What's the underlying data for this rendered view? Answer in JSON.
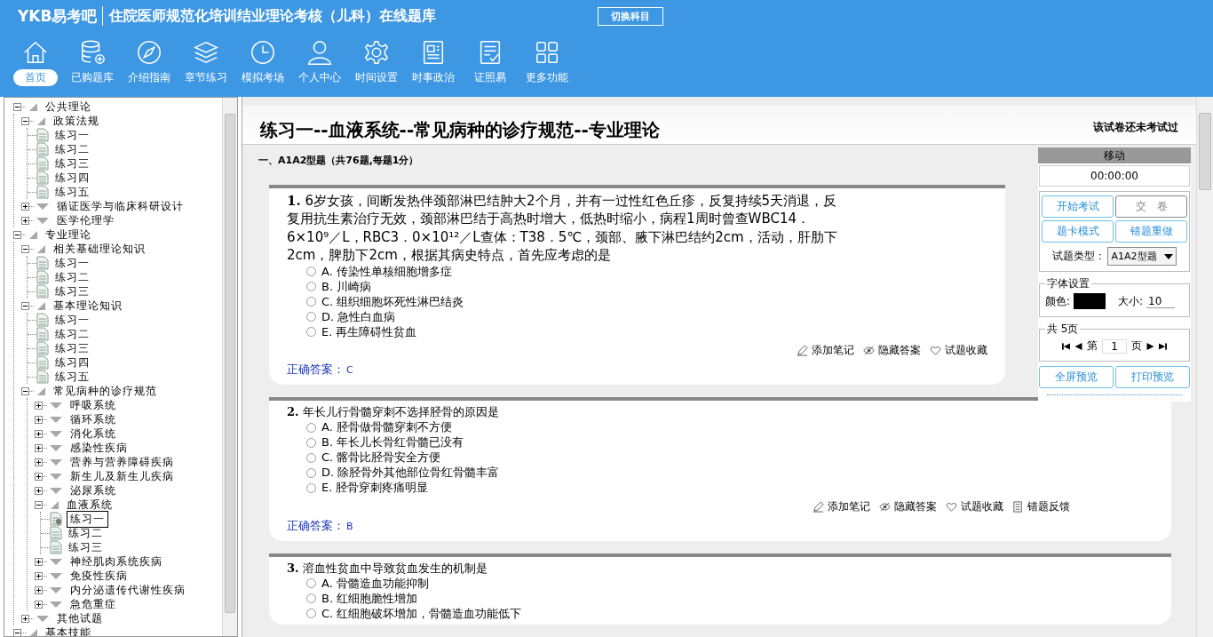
{
  "app": {
    "logo": "YKB易考吧",
    "title": "住院医师规范化培训结业理论考核（儿科）在线题库",
    "switch_button": "切换科目"
  },
  "nav": [
    {
      "label": "首页",
      "selected": true
    },
    {
      "label": "已购题库",
      "selected": false
    },
    {
      "label": "介绍指南",
      "selected": false
    },
    {
      "label": "章节练习",
      "selected": false
    },
    {
      "label": "模拟考场",
      "selected": false
    },
    {
      "label": "个人中心",
      "selected": false
    },
    {
      "label": "时间设置",
      "selected": false
    },
    {
      "label": "时事政治",
      "selected": false
    },
    {
      "label": "证照易",
      "selected": false
    },
    {
      "label": "更多功能",
      "selected": false
    }
  ],
  "tree": [
    {
      "label": "公共理论",
      "kind": "folder",
      "expanded": true,
      "children": [
        {
          "label": "政策法规",
          "kind": "folder",
          "expanded": true,
          "children": [
            {
              "label": "练习一",
              "kind": "doc",
              "selected": false
            },
            {
              "label": "练习二",
              "kind": "doc",
              "selected": false
            },
            {
              "label": "练习三",
              "kind": "doc",
              "selected": false
            },
            {
              "label": "练习四",
              "kind": "doc",
              "selected": false
            },
            {
              "label": "练习五",
              "kind": "doc",
              "selected": false
            }
          ]
        },
        {
          "label": "循证医学与临床科研设计",
          "kind": "folder",
          "expanded": false
        },
        {
          "label": "医学伦理学",
          "kind": "folder",
          "expanded": false
        }
      ]
    },
    {
      "label": "专业理论",
      "kind": "folder",
      "expanded": true,
      "children": [
        {
          "label": "相关基础理论知识",
          "kind": "folder",
          "expanded": true,
          "children": [
            {
              "label": "练习一",
              "kind": "doc",
              "selected": false
            },
            {
              "label": "练习二",
              "kind": "doc",
              "selected": false
            },
            {
              "label": "练习三",
              "kind": "doc",
              "selected": false
            }
          ]
        },
        {
          "label": "基本理论知识",
          "kind": "folder",
          "expanded": true,
          "children": [
            {
              "label": "练习一",
              "kind": "doc",
              "selected": false
            },
            {
              "label": "练习二",
              "kind": "doc",
              "selected": false
            },
            {
              "label": "练习三",
              "kind": "doc",
              "selected": false
            },
            {
              "label": "练习四",
              "kind": "doc",
              "selected": false
            },
            {
              "label": "练习五",
              "kind": "doc",
              "selected": false
            }
          ]
        },
        {
          "label": "常见病种的诊疗规范",
          "kind": "folder",
          "expanded": true,
          "children": [
            {
              "label": "呼吸系统",
              "kind": "folder",
              "expanded": false
            },
            {
              "label": "循环系统",
              "kind": "folder",
              "expanded": false
            },
            {
              "label": "消化系统",
              "kind": "folder",
              "expanded": false
            },
            {
              "label": "感染性疾病",
              "kind": "folder",
              "expanded": false
            },
            {
              "label": "营养与营养障碍疾病",
              "kind": "folder",
              "expanded": false
            },
            {
              "label": "新生儿及新生儿疾病",
              "kind": "folder",
              "expanded": false
            },
            {
              "label": "泌尿系统",
              "kind": "folder",
              "expanded": false
            },
            {
              "label": "血液系统",
              "kind": "folder",
              "expanded": true,
              "children": [
                {
                  "label": "练习一",
                  "kind": "doc",
                  "selected": true
                },
                {
                  "label": "练习二",
                  "kind": "doc",
                  "selected": false
                },
                {
                  "label": "练习三",
                  "kind": "doc",
                  "selected": false
                }
              ]
            },
            {
              "label": "神经肌肉系统疾病",
              "kind": "folder",
              "expanded": false
            },
            {
              "label": "免疫性疾病",
              "kind": "folder",
              "expanded": false
            },
            {
              "label": "内分泌遗传代谢性疾病",
              "kind": "folder",
              "expanded": false
            },
            {
              "label": "急危重症",
              "kind": "folder",
              "expanded": false
            }
          ]
        },
        {
          "label": "其他试题",
          "kind": "folder",
          "expanded": false
        }
      ]
    },
    {
      "label": "基本技能",
      "kind": "folder",
      "expanded": true
    }
  ],
  "exam": {
    "title": "练习一--血液系统--常见病种的诊疗规范--专业理论",
    "status": "该试卷还未考试过",
    "section": "一、A1A2型题（共76题,每题1分）",
    "questions": [
      {
        "number": "1.",
        "text": "6岁女孩，间断发热伴颈部淋巴结肿大2个月，并有一过性红色丘疹，反复持续5天消退，反复用抗生素治疗无效，颈部淋巴结于高热时增大，低热时缩小，病程1周时曾查WBC14．6×10⁹／L，RBC3．0×10¹²／L查体：T38．5℃，颈部、腋下淋巴结约2cm，活动，肝肋下2cm，脾肋下2cm，根据其病史特点，首先应考虑的是",
        "options": [
          {
            "label": "A. 传染性单核细胞增多症",
            "checked": false
          },
          {
            "label": "B. 川崎病",
            "checked": false
          },
          {
            "label": "C. 组织细胞坏死性淋巴结炎",
            "checked": false
          },
          {
            "label": "D. 急性白血病",
            "checked": false
          },
          {
            "label": "E. 再生障碍性贫血",
            "checked": false
          }
        ],
        "actions": [
          {
            "kind": "note",
            "label": "添加笔记"
          },
          {
            "kind": "hide",
            "label": "隐藏答案"
          },
          {
            "kind": "favorite",
            "label": "试题收藏"
          }
        ],
        "answer_label": "正确答案：",
        "answer": "C"
      },
      {
        "number": "2.",
        "text": "年长儿行骨髓穿刺不选择胫骨的原因是",
        "options": [
          {
            "label": "A. 胫骨做骨髓穿刺不方便",
            "checked": false
          },
          {
            "label": "B. 年长儿长骨红骨髓已没有",
            "checked": false
          },
          {
            "label": "C. 髂骨比胫骨安全方便",
            "checked": false
          },
          {
            "label": "D. 除胫骨外其他部位骨红骨髓丰富",
            "checked": false
          },
          {
            "label": "E. 胫骨穿刺疼痛明显",
            "checked": false
          }
        ],
        "actions": [
          {
            "kind": "note",
            "label": "添加笔记"
          },
          {
            "kind": "hide",
            "label": "隐藏答案"
          },
          {
            "kind": "favorite",
            "label": "试题收藏"
          },
          {
            "kind": "feedback",
            "label": "错题反馈"
          }
        ],
        "answer_label": "正确答案：",
        "answer": "B"
      },
      {
        "number": "3.",
        "text": "溶血性贫血中导致贫血发生的机制是",
        "options": [
          {
            "label": "A. 骨髓造血功能抑制",
            "checked": false
          },
          {
            "label": "B. 红细胞脆性增加",
            "checked": false
          },
          {
            "label": "C. 红细胞破坏增加，骨髓造血功能低下",
            "checked": false
          }
        ]
      }
    ]
  },
  "panel": {
    "header": "移动",
    "timer": "00:00:00",
    "buttons": [
      {
        "label": "开始考试",
        "disabled": false
      },
      {
        "label": "交　卷",
        "disabled": true
      },
      {
        "label": "题卡模式",
        "disabled": false
      },
      {
        "label": "错题重做",
        "disabled": false
      }
    ],
    "type_label": "试题类型：",
    "type_value": "A1A2型题",
    "font": {
      "legend": "字体设置",
      "color_label": "颜色:",
      "color": "#000000",
      "size_label": "大小:",
      "size": "10"
    },
    "pages": {
      "legend": "共 5页",
      "before": "第",
      "page": "1",
      "after": "页"
    },
    "bottom_buttons": [
      "全屏预览",
      "打印预览"
    ]
  }
}
